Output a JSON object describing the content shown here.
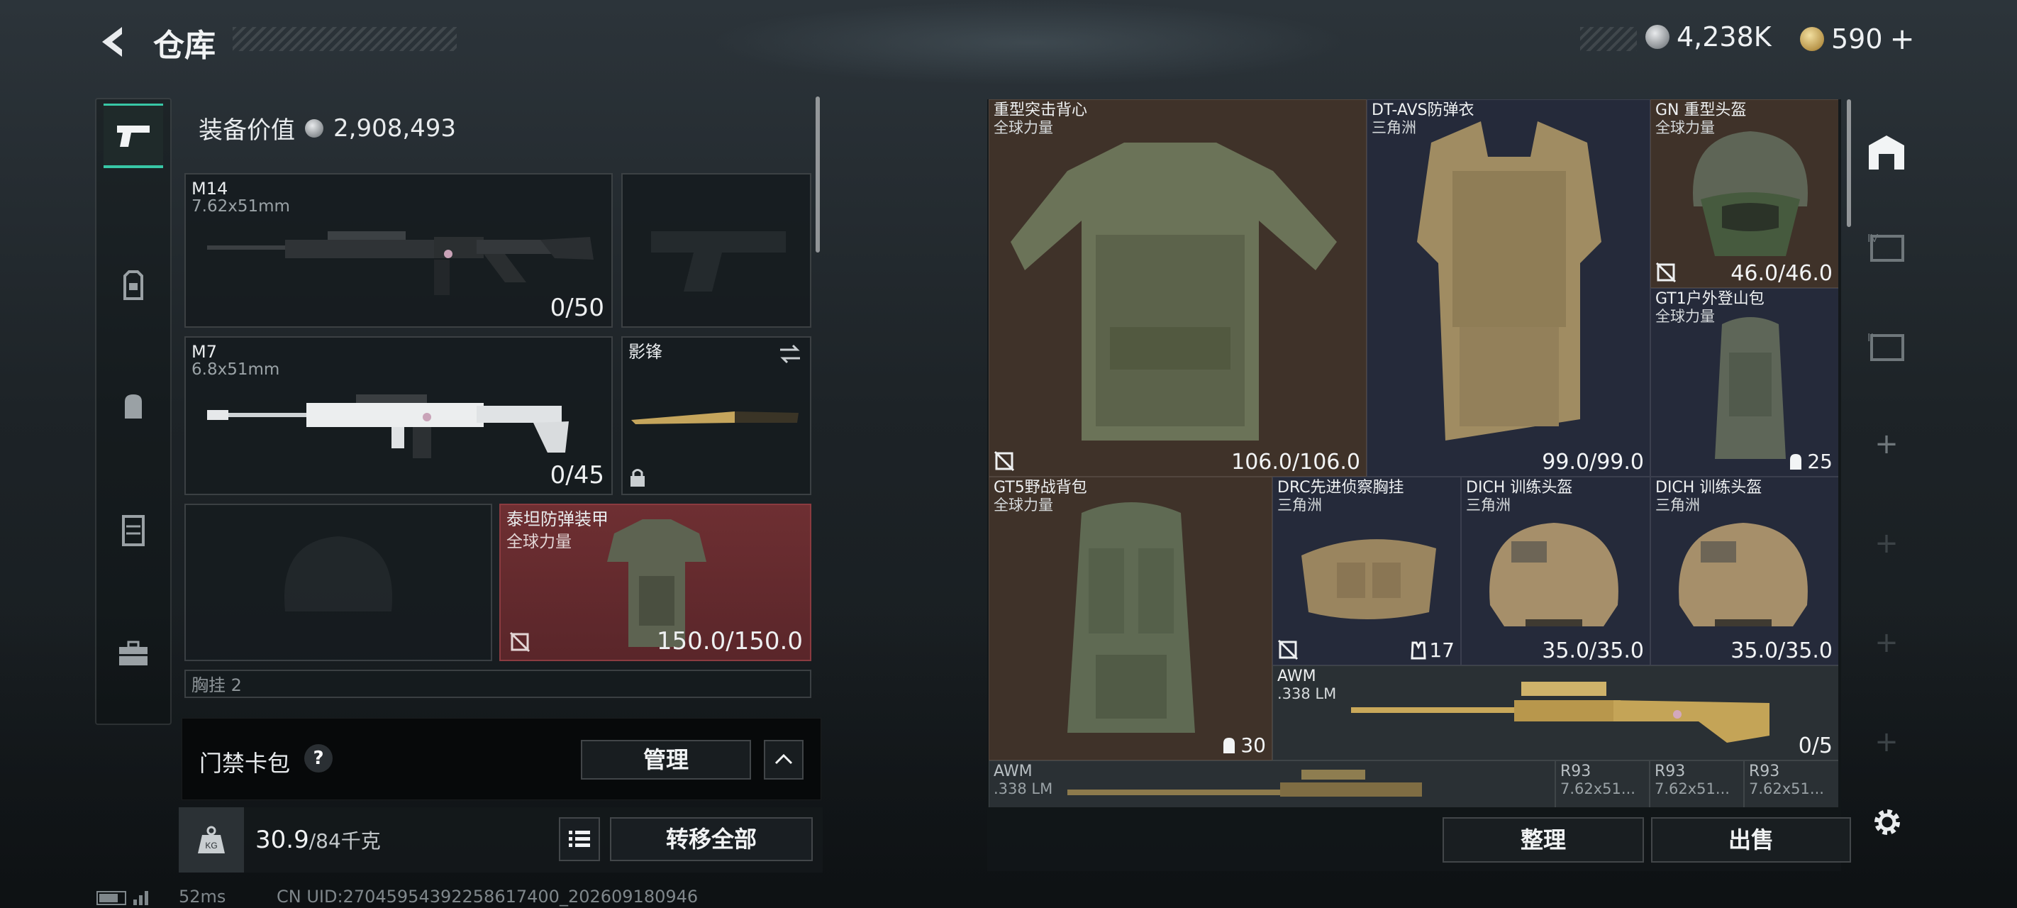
{
  "header": {
    "title": "仓库",
    "silver_amount": "4,238K",
    "gold_amount": "590",
    "gold_add": "+"
  },
  "loadout": {
    "equipment_value_label": "装备价值",
    "equipment_value": "2,908,493",
    "primary": {
      "name": "M14",
      "caliber": "7.62x51mm",
      "ammo": "0/50"
    },
    "secondary": {
      "name": "M7",
      "caliber": "6.8x51mm",
      "ammo": "0/45"
    },
    "melee": {
      "name": "影锋"
    },
    "armor": {
      "name": "泰坦防弹装甲",
      "faction": "全球力量",
      "durability": "150.0/150.0"
    },
    "cut_label": "胸挂 2"
  },
  "card_pack": {
    "label": "门禁卡包",
    "help": "?",
    "manage_button": "管理"
  },
  "weight": {
    "current": "30.9",
    "max": "/84千克",
    "transfer_all": "转移全部"
  },
  "status": {
    "ping": "52ms",
    "uid": "CN UID:27045954392258617400_202609180946"
  },
  "warehouse": {
    "items": [
      {
        "name": "重型突击背心",
        "sub": "全球力量",
        "value": "106.0/106.0"
      },
      {
        "name": "DT-AVS防弹衣",
        "sub": "三角洲",
        "value": "99.0/99.0"
      },
      {
        "name": "GN 重型头盔",
        "sub": "全球力量",
        "value": "46.0/46.0"
      },
      {
        "name": "GT1户外登山包",
        "sub": "全球力量",
        "value": "25"
      },
      {
        "name": "GT5野战背包",
        "sub": "全球力量",
        "value": "30"
      },
      {
        "name": "DRC先进侦察胸挂",
        "sub": "三角洲",
        "value": "17"
      },
      {
        "name": "DICH 训练头盔",
        "sub": "三角洲",
        "value": "35.0/35.0"
      },
      {
        "name": "DICH 训练头盔",
        "sub": "三角洲",
        "value": "35.0/35.0"
      },
      {
        "name": "AWM",
        "sub": ".338 LM",
        "value": "0/5"
      },
      {
        "name": "AWM",
        "sub": ".338 LM"
      },
      {
        "name": "R93",
        "sub": "7.62x51..."
      },
      {
        "name": "R93",
        "sub": "7.62x51..."
      },
      {
        "name": "R93",
        "sub": "7.62x51..."
      }
    ],
    "sort_button": "整理",
    "sell_button": "出售"
  },
  "colors": {
    "accent_teal": "#38c7a6",
    "armor_red": "#6e2f32",
    "legendary_brown": "#3f3229",
    "epic_navy": "#252a3a"
  },
  "icons": [
    "back-arrow-icon",
    "silver-coin-icon",
    "gold-coin-icon",
    "pistol-icon",
    "backpack-icon",
    "bag-icon",
    "vest-icon",
    "toolbox-icon",
    "help-icon",
    "chevron-up-icon",
    "weight-icon",
    "list-icon",
    "no-repair-icon",
    "lock-icon",
    "swap-icon",
    "warehouse-icon",
    "settings-icon",
    "plus-icon"
  ]
}
